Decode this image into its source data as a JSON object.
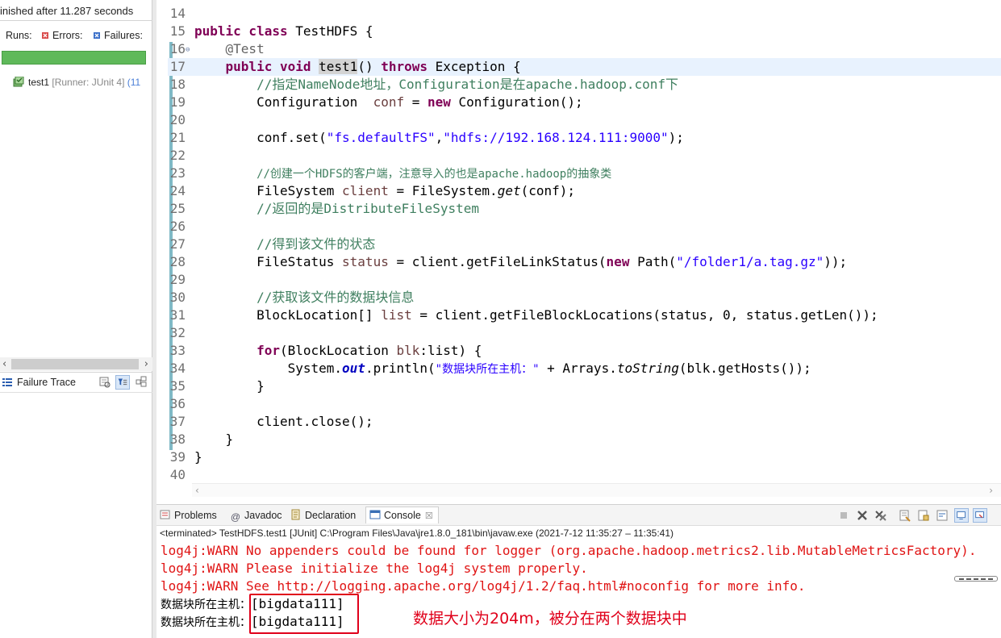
{
  "junit": {
    "status_text": "inished after 11.287 seconds",
    "runs_label": "Runs:",
    "errors_label": "Errors:",
    "failures_label": "Failures:",
    "progress": 1.0,
    "progress_color": "#5fb95a",
    "test_name": "test1",
    "test_runner": "[Runner: JUnit 4]",
    "test_time": "(11",
    "failure_trace_label": "Failure Trace"
  },
  "editor": {
    "lines": [
      {
        "n": "14"
      },
      {
        "n": "15"
      },
      {
        "n": "16"
      },
      {
        "n": "17"
      },
      {
        "n": "18"
      },
      {
        "n": "19"
      },
      {
        "n": "20"
      },
      {
        "n": "21"
      },
      {
        "n": "22"
      },
      {
        "n": "23"
      },
      {
        "n": "24"
      },
      {
        "n": "25"
      },
      {
        "n": "26"
      },
      {
        "n": "27"
      },
      {
        "n": "28"
      },
      {
        "n": "29"
      },
      {
        "n": "30"
      },
      {
        "n": "31"
      },
      {
        "n": "32"
      },
      {
        "n": "33"
      },
      {
        "n": "34"
      },
      {
        "n": "35"
      },
      {
        "n": "36"
      },
      {
        "n": "37"
      },
      {
        "n": "38"
      },
      {
        "n": "39"
      },
      {
        "n": "40"
      }
    ],
    "code": {
      "l15_kw": "public class",
      "l15_rest": " TestHDFS {",
      "l16": "@Test",
      "l17_kw1": "public void",
      "l17_sp": " ",
      "l17_name": "test1",
      "l17_paren": "() ",
      "l17_kw2": "throws",
      "l17_rest": " Exception {",
      "l18": "//指定NameNode地址，Configuration是在apache.hadoop.conf下",
      "l19_a": "Configuration  ",
      "l19_var": "conf",
      "l19_b": " = ",
      "l19_kw": "new",
      "l19_c": " Configuration();",
      "l21_a": "conf.set(",
      "l21_s1": "\"fs.defaultFS\"",
      "l21_comma": ",",
      "l21_s2": "\"hdfs://192.168.124.111:9000\"",
      "l21_end": ");",
      "l23": "//创建一个HDFS的客户端，注意导入的也是apache.hadoop的抽象类",
      "l24_a": "FileSystem ",
      "l24_var": "client",
      "l24_b": " = FileSystem.",
      "l24_it": "get",
      "l24_c": "(conf);",
      "l25": "//返回的是DistributeFileSystem",
      "l27": "//得到该文件的状态",
      "l28_a": "FileStatus ",
      "l28_var": "status",
      "l28_b": " = client.getFileLinkStatus(",
      "l28_kw": "new",
      "l28_c": " Path(",
      "l28_s": "\"/folder1/a.tag.gz\"",
      "l28_end": "));",
      "l30": "//获取该文件的数据块信息",
      "l31_a": "BlockLocation[] ",
      "l31_var": "list",
      "l31_b": " = client.getFileBlockLocations(status, 0, status.getLen());",
      "l33_kw": "for",
      "l33_a": "(BlockLocation ",
      "l33_var": "blk",
      "l33_b": ":list) {",
      "l34_a": "System.",
      "l34_fld": "out",
      "l34_b": ".println(",
      "l34_s": "\"数据块所在主机：\"",
      "l34_c": " + Arrays.",
      "l34_it": "toString",
      "l34_d": "(blk.getHosts());",
      "l35": "}",
      "l37": "client.close();",
      "l38": "}",
      "l39": "}"
    }
  },
  "console": {
    "tabs": [
      {
        "label": "Problems",
        "icon": "problems-icon"
      },
      {
        "label": "Javadoc",
        "icon": "javadoc-icon"
      },
      {
        "label": "Declaration",
        "icon": "declaration-icon"
      },
      {
        "label": "Console",
        "icon": "console-icon",
        "active": true
      }
    ],
    "terminated": "<terminated> TestHDFS.test1 [JUnit] C:\\Program Files\\Java\\jre1.8.0_181\\bin\\javaw.exe  (2021-7-12 11:35:27 – 11:35:41)",
    "warn_lines": [
      "log4j:WARN No appenders could be found for logger (org.apache.hadoop.metrics2.lib.MutableMetricsFactory).",
      "log4j:WARN Please initialize the log4j system properly.",
      "log4j:WARN See http://logging.apache.org/log4j/1.2/faq.html#noconfig for more info."
    ],
    "output_lines": [
      {
        "prefix": "数据块所在主机：",
        "value": "[bigdata111]"
      },
      {
        "prefix": "数据块所在主机：",
        "value": "[bigdata111]"
      }
    ],
    "annotation": "数据大小为204m，被分在两个数据块中",
    "annotation_color": "#e0001a"
  }
}
